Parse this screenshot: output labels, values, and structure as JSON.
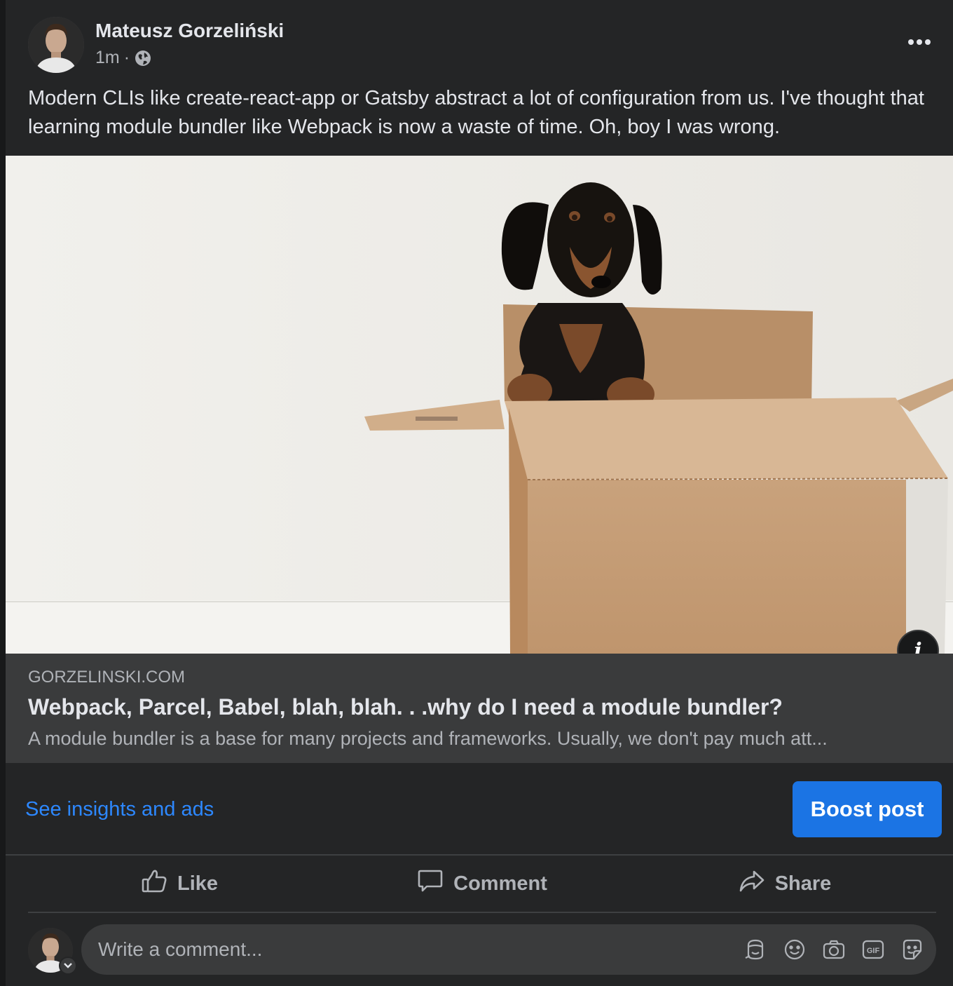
{
  "post": {
    "author": "Mateusz Gorzeliński",
    "time": "1m",
    "separator": "·",
    "privacy_icon": "globe-icon",
    "text": "Modern CLIs like create-react-app or Gatsby abstract a lot of configuration from us. I've thought that learning module bundler like Webpack is now a waste of time. Oh, boy I was wrong."
  },
  "link_preview": {
    "domain": "GORZELINSKI.COM",
    "title": "Webpack, Parcel, Babel, blah, blah. . .why do I need a module bundler?",
    "description": "A module bundler is a base for many projects and frameworks. Usually, we don't pay much att...",
    "info_label": "i"
  },
  "promo": {
    "insights_label": "See insights and ads",
    "boost_label": "Boost post"
  },
  "actions": {
    "like": "Like",
    "comment": "Comment",
    "share": "Share"
  },
  "comment": {
    "placeholder": "Write a comment...",
    "icons": [
      "avatar-sticker-icon",
      "emoji-icon",
      "camera-icon",
      "gif-icon",
      "sticker-icon"
    ]
  },
  "colors": {
    "card_bg": "#242526",
    "link_blue": "#2d88ff",
    "boost_bg": "#1b74e4",
    "secondary_text": "#b0b3b8"
  }
}
